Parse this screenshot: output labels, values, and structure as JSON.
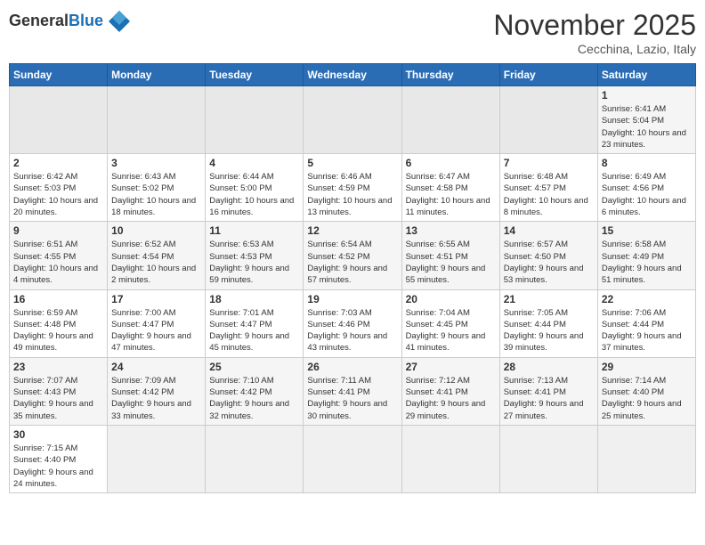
{
  "logo": {
    "general": "General",
    "blue": "Blue"
  },
  "header": {
    "month": "November 2025",
    "location": "Cecchina, Lazio, Italy"
  },
  "days_of_week": [
    "Sunday",
    "Monday",
    "Tuesday",
    "Wednesday",
    "Thursday",
    "Friday",
    "Saturday"
  ],
  "weeks": [
    [
      {
        "day": "",
        "info": ""
      },
      {
        "day": "",
        "info": ""
      },
      {
        "day": "",
        "info": ""
      },
      {
        "day": "",
        "info": ""
      },
      {
        "day": "",
        "info": ""
      },
      {
        "day": "",
        "info": ""
      },
      {
        "day": "1",
        "info": "Sunrise: 6:41 AM\nSunset: 5:04 PM\nDaylight: 10 hours and 23 minutes."
      }
    ],
    [
      {
        "day": "2",
        "info": "Sunrise: 6:42 AM\nSunset: 5:03 PM\nDaylight: 10 hours and 20 minutes."
      },
      {
        "day": "3",
        "info": "Sunrise: 6:43 AM\nSunset: 5:02 PM\nDaylight: 10 hours and 18 minutes."
      },
      {
        "day": "4",
        "info": "Sunrise: 6:44 AM\nSunset: 5:00 PM\nDaylight: 10 hours and 16 minutes."
      },
      {
        "day": "5",
        "info": "Sunrise: 6:46 AM\nSunset: 4:59 PM\nDaylight: 10 hours and 13 minutes."
      },
      {
        "day": "6",
        "info": "Sunrise: 6:47 AM\nSunset: 4:58 PM\nDaylight: 10 hours and 11 minutes."
      },
      {
        "day": "7",
        "info": "Sunrise: 6:48 AM\nSunset: 4:57 PM\nDaylight: 10 hours and 8 minutes."
      },
      {
        "day": "8",
        "info": "Sunrise: 6:49 AM\nSunset: 4:56 PM\nDaylight: 10 hours and 6 minutes."
      }
    ],
    [
      {
        "day": "9",
        "info": "Sunrise: 6:51 AM\nSunset: 4:55 PM\nDaylight: 10 hours and 4 minutes."
      },
      {
        "day": "10",
        "info": "Sunrise: 6:52 AM\nSunset: 4:54 PM\nDaylight: 10 hours and 2 minutes."
      },
      {
        "day": "11",
        "info": "Sunrise: 6:53 AM\nSunset: 4:53 PM\nDaylight: 9 hours and 59 minutes."
      },
      {
        "day": "12",
        "info": "Sunrise: 6:54 AM\nSunset: 4:52 PM\nDaylight: 9 hours and 57 minutes."
      },
      {
        "day": "13",
        "info": "Sunrise: 6:55 AM\nSunset: 4:51 PM\nDaylight: 9 hours and 55 minutes."
      },
      {
        "day": "14",
        "info": "Sunrise: 6:57 AM\nSunset: 4:50 PM\nDaylight: 9 hours and 53 minutes."
      },
      {
        "day": "15",
        "info": "Sunrise: 6:58 AM\nSunset: 4:49 PM\nDaylight: 9 hours and 51 minutes."
      }
    ],
    [
      {
        "day": "16",
        "info": "Sunrise: 6:59 AM\nSunset: 4:48 PM\nDaylight: 9 hours and 49 minutes."
      },
      {
        "day": "17",
        "info": "Sunrise: 7:00 AM\nSunset: 4:47 PM\nDaylight: 9 hours and 47 minutes."
      },
      {
        "day": "18",
        "info": "Sunrise: 7:01 AM\nSunset: 4:47 PM\nDaylight: 9 hours and 45 minutes."
      },
      {
        "day": "19",
        "info": "Sunrise: 7:03 AM\nSunset: 4:46 PM\nDaylight: 9 hours and 43 minutes."
      },
      {
        "day": "20",
        "info": "Sunrise: 7:04 AM\nSunset: 4:45 PM\nDaylight: 9 hours and 41 minutes."
      },
      {
        "day": "21",
        "info": "Sunrise: 7:05 AM\nSunset: 4:44 PM\nDaylight: 9 hours and 39 minutes."
      },
      {
        "day": "22",
        "info": "Sunrise: 7:06 AM\nSunset: 4:44 PM\nDaylight: 9 hours and 37 minutes."
      }
    ],
    [
      {
        "day": "23",
        "info": "Sunrise: 7:07 AM\nSunset: 4:43 PM\nDaylight: 9 hours and 35 minutes."
      },
      {
        "day": "24",
        "info": "Sunrise: 7:09 AM\nSunset: 4:42 PM\nDaylight: 9 hours and 33 minutes."
      },
      {
        "day": "25",
        "info": "Sunrise: 7:10 AM\nSunset: 4:42 PM\nDaylight: 9 hours and 32 minutes."
      },
      {
        "day": "26",
        "info": "Sunrise: 7:11 AM\nSunset: 4:41 PM\nDaylight: 9 hours and 30 minutes."
      },
      {
        "day": "27",
        "info": "Sunrise: 7:12 AM\nSunset: 4:41 PM\nDaylight: 9 hours and 29 minutes."
      },
      {
        "day": "28",
        "info": "Sunrise: 7:13 AM\nSunset: 4:41 PM\nDaylight: 9 hours and 27 minutes."
      },
      {
        "day": "29",
        "info": "Sunrise: 7:14 AM\nSunset: 4:40 PM\nDaylight: 9 hours and 25 minutes."
      }
    ],
    [
      {
        "day": "30",
        "info": "Sunrise: 7:15 AM\nSunset: 4:40 PM\nDaylight: 9 hours and 24 minutes."
      },
      {
        "day": "",
        "info": ""
      },
      {
        "day": "",
        "info": ""
      },
      {
        "day": "",
        "info": ""
      },
      {
        "day": "",
        "info": ""
      },
      {
        "day": "",
        "info": ""
      },
      {
        "day": "",
        "info": ""
      }
    ]
  ]
}
